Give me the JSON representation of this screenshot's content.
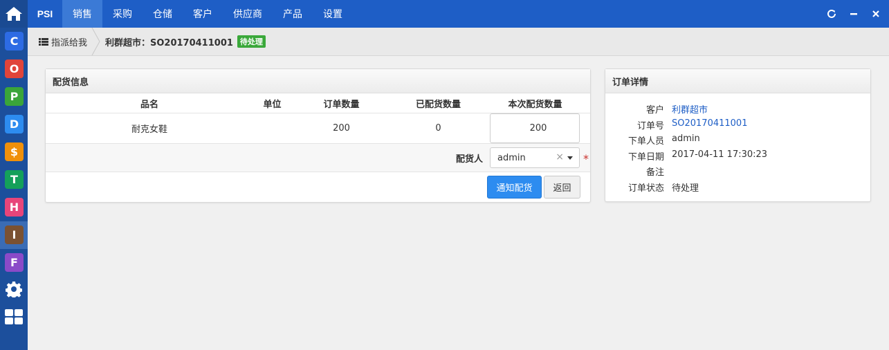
{
  "app": {
    "brand": "PSI"
  },
  "top_menu": [
    "销售",
    "采购",
    "仓储",
    "客户",
    "供应商",
    "产品",
    "设置"
  ],
  "top_menu_active": "销售",
  "window_controls": {
    "refresh": "refresh-icon",
    "minimize": "minimize-icon",
    "close": "close-icon"
  },
  "side_apps": [
    {
      "letter": "C",
      "color": "#2d6be4"
    },
    {
      "letter": "O",
      "color": "#e0443a"
    },
    {
      "letter": "P",
      "color": "#3aa53a"
    },
    {
      "letter": "D",
      "color": "#2d8cf0"
    },
    {
      "letter": "$",
      "color": "#f0900a"
    },
    {
      "letter": "T",
      "color": "#14a05a"
    },
    {
      "letter": "H",
      "color": "#e8457a"
    },
    {
      "letter": "I",
      "color": "#7a5132"
    },
    {
      "letter": "F",
      "color": "#8a4ac8"
    }
  ],
  "breadcrumb": {
    "first": "指派给我",
    "title": "利群超市：SO20170411001",
    "status": "待处理"
  },
  "distribution": {
    "title": "配货信息",
    "columns": [
      "品名",
      "单位",
      "订单数量",
      "已配货数量",
      "本次配货数量"
    ],
    "row": {
      "name": "耐克女鞋",
      "unit": "",
      "order_qty": "200",
      "distributed_qty": "0",
      "this_qty": "200"
    },
    "assignee_label": "配货人",
    "assignee_value": "admin",
    "notify_button": "通知配货",
    "back_button": "返回"
  },
  "order": {
    "title": "订单详情",
    "rows": [
      {
        "label": "客户",
        "value": "利群超市",
        "link": true
      },
      {
        "label": "订单号",
        "value": "SO20170411001",
        "link": true
      },
      {
        "label": "下单人员",
        "value": "admin",
        "link": false
      },
      {
        "label": "下单日期",
        "value": "2017-04-11 17:30:23",
        "link": false
      },
      {
        "label": "备注",
        "value": "",
        "link": false
      },
      {
        "label": "订单状态",
        "value": "待处理",
        "link": false
      }
    ]
  }
}
